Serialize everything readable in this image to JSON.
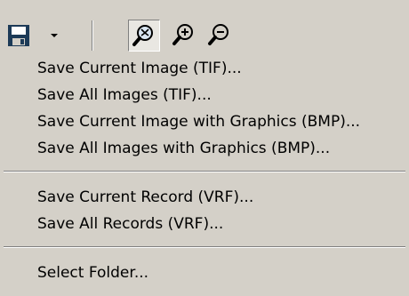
{
  "toolbar": {
    "buttons": [
      {
        "icon": "floppy-disk-icon"
      },
      {
        "icon": "dropdown-arrow-icon"
      },
      {
        "icon": "zoom-all-icon",
        "pressed": true
      },
      {
        "icon": "zoom-in-icon"
      },
      {
        "icon": "zoom-out-icon"
      }
    ]
  },
  "menu": {
    "groups": [
      [
        "Save Current Image (TIF)...",
        "Save All Images (TIF)...",
        "Save Current Image with Graphics (BMP)...",
        "Save All Images with Graphics (BMP)..."
      ],
      [
        "Save Current Record (VRF)...",
        "Save All Records (VRF)..."
      ],
      [
        "Select Folder..."
      ]
    ]
  },
  "colors": {
    "background": "#d4d0c8",
    "highlight": "#ffffff",
    "shadow": "#808080",
    "icon_dark": "#1c3a57"
  }
}
